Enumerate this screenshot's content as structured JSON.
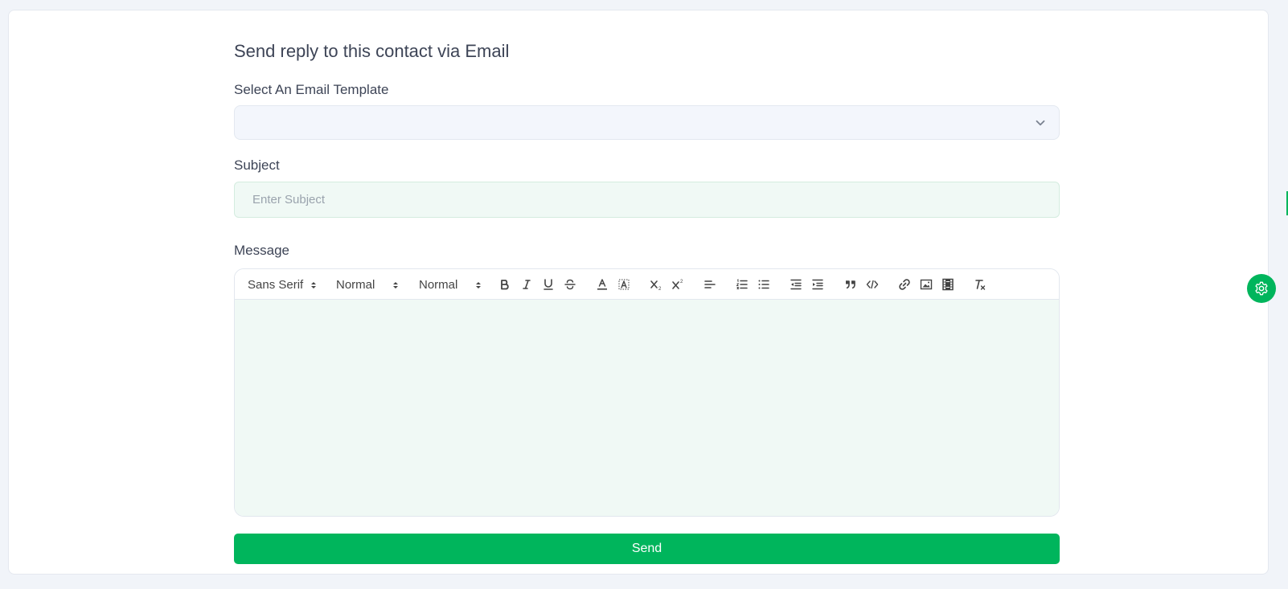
{
  "page": {
    "title": "Send reply to this contact via Email"
  },
  "template": {
    "label": "Select An Email Template",
    "selected_value": ""
  },
  "subject": {
    "label": "Subject",
    "placeholder": "Enter Subject",
    "value": ""
  },
  "message": {
    "label": "Message",
    "toolbar": {
      "font": "Sans Serif",
      "size": "Normal",
      "header": "Normal",
      "buttons": [
        "bold-icon",
        "italic-icon",
        "underline-icon",
        "strikethrough-icon",
        "text-color-icon",
        "background-color-icon",
        "subscript-icon",
        "superscript-icon",
        "align-left-icon",
        "ordered-list-icon",
        "bullet-list-icon",
        "outdent-icon",
        "indent-icon",
        "blockquote-icon",
        "code-block-icon",
        "link-icon",
        "image-icon",
        "video-icon",
        "clear-format-icon"
      ]
    },
    "body": ""
  },
  "actions": {
    "send_label": "Send"
  },
  "colors": {
    "accent": "#00b55c",
    "page_bg": "#f1f4f9",
    "field_bg": "#f0f9f5",
    "text": "#3d4456"
  }
}
